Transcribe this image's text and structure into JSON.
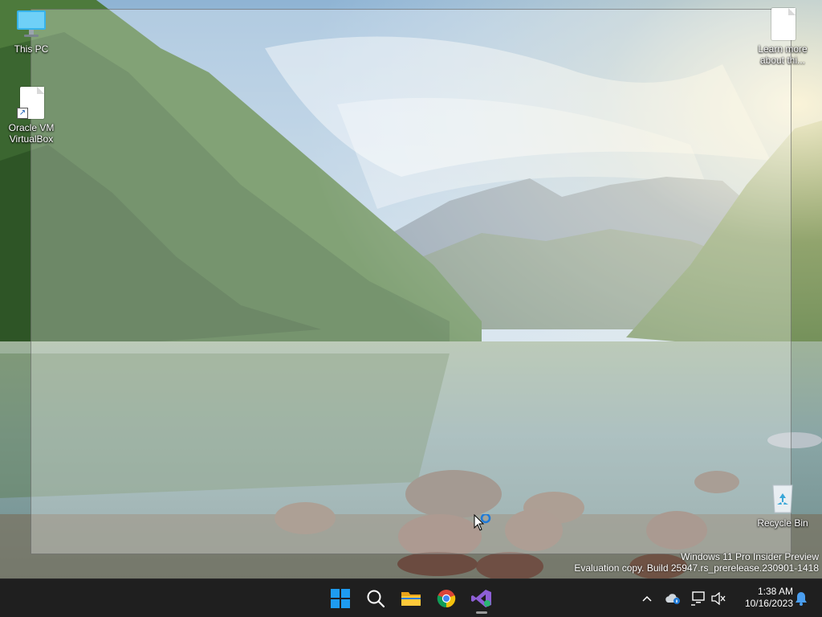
{
  "desktop": {
    "icons": [
      {
        "label": "This PC"
      },
      {
        "label": "Oracle VM VirtualBox"
      },
      {
        "label": "Learn more about thi..."
      },
      {
        "label": "Recycle Bin"
      }
    ]
  },
  "watermark": {
    "line1": "Windows 11 Pro Insider Preview",
    "line2": "Evaluation copy. Build 25947.rs_prerelease.230901-1418"
  },
  "taskbar": {
    "apps": [
      {
        "name": "start-icon"
      },
      {
        "name": "search-icon"
      },
      {
        "name": "file-explorer-icon"
      },
      {
        "name": "chrome-icon"
      },
      {
        "name": "visual-studio-icon",
        "active": true
      }
    ],
    "tray": {
      "chevron": "^",
      "time": "1:38 AM",
      "date": "10/16/2023"
    }
  },
  "colors": {
    "taskbar_bg": "#1f1f1f",
    "start_blue": "#1e9bf0"
  }
}
